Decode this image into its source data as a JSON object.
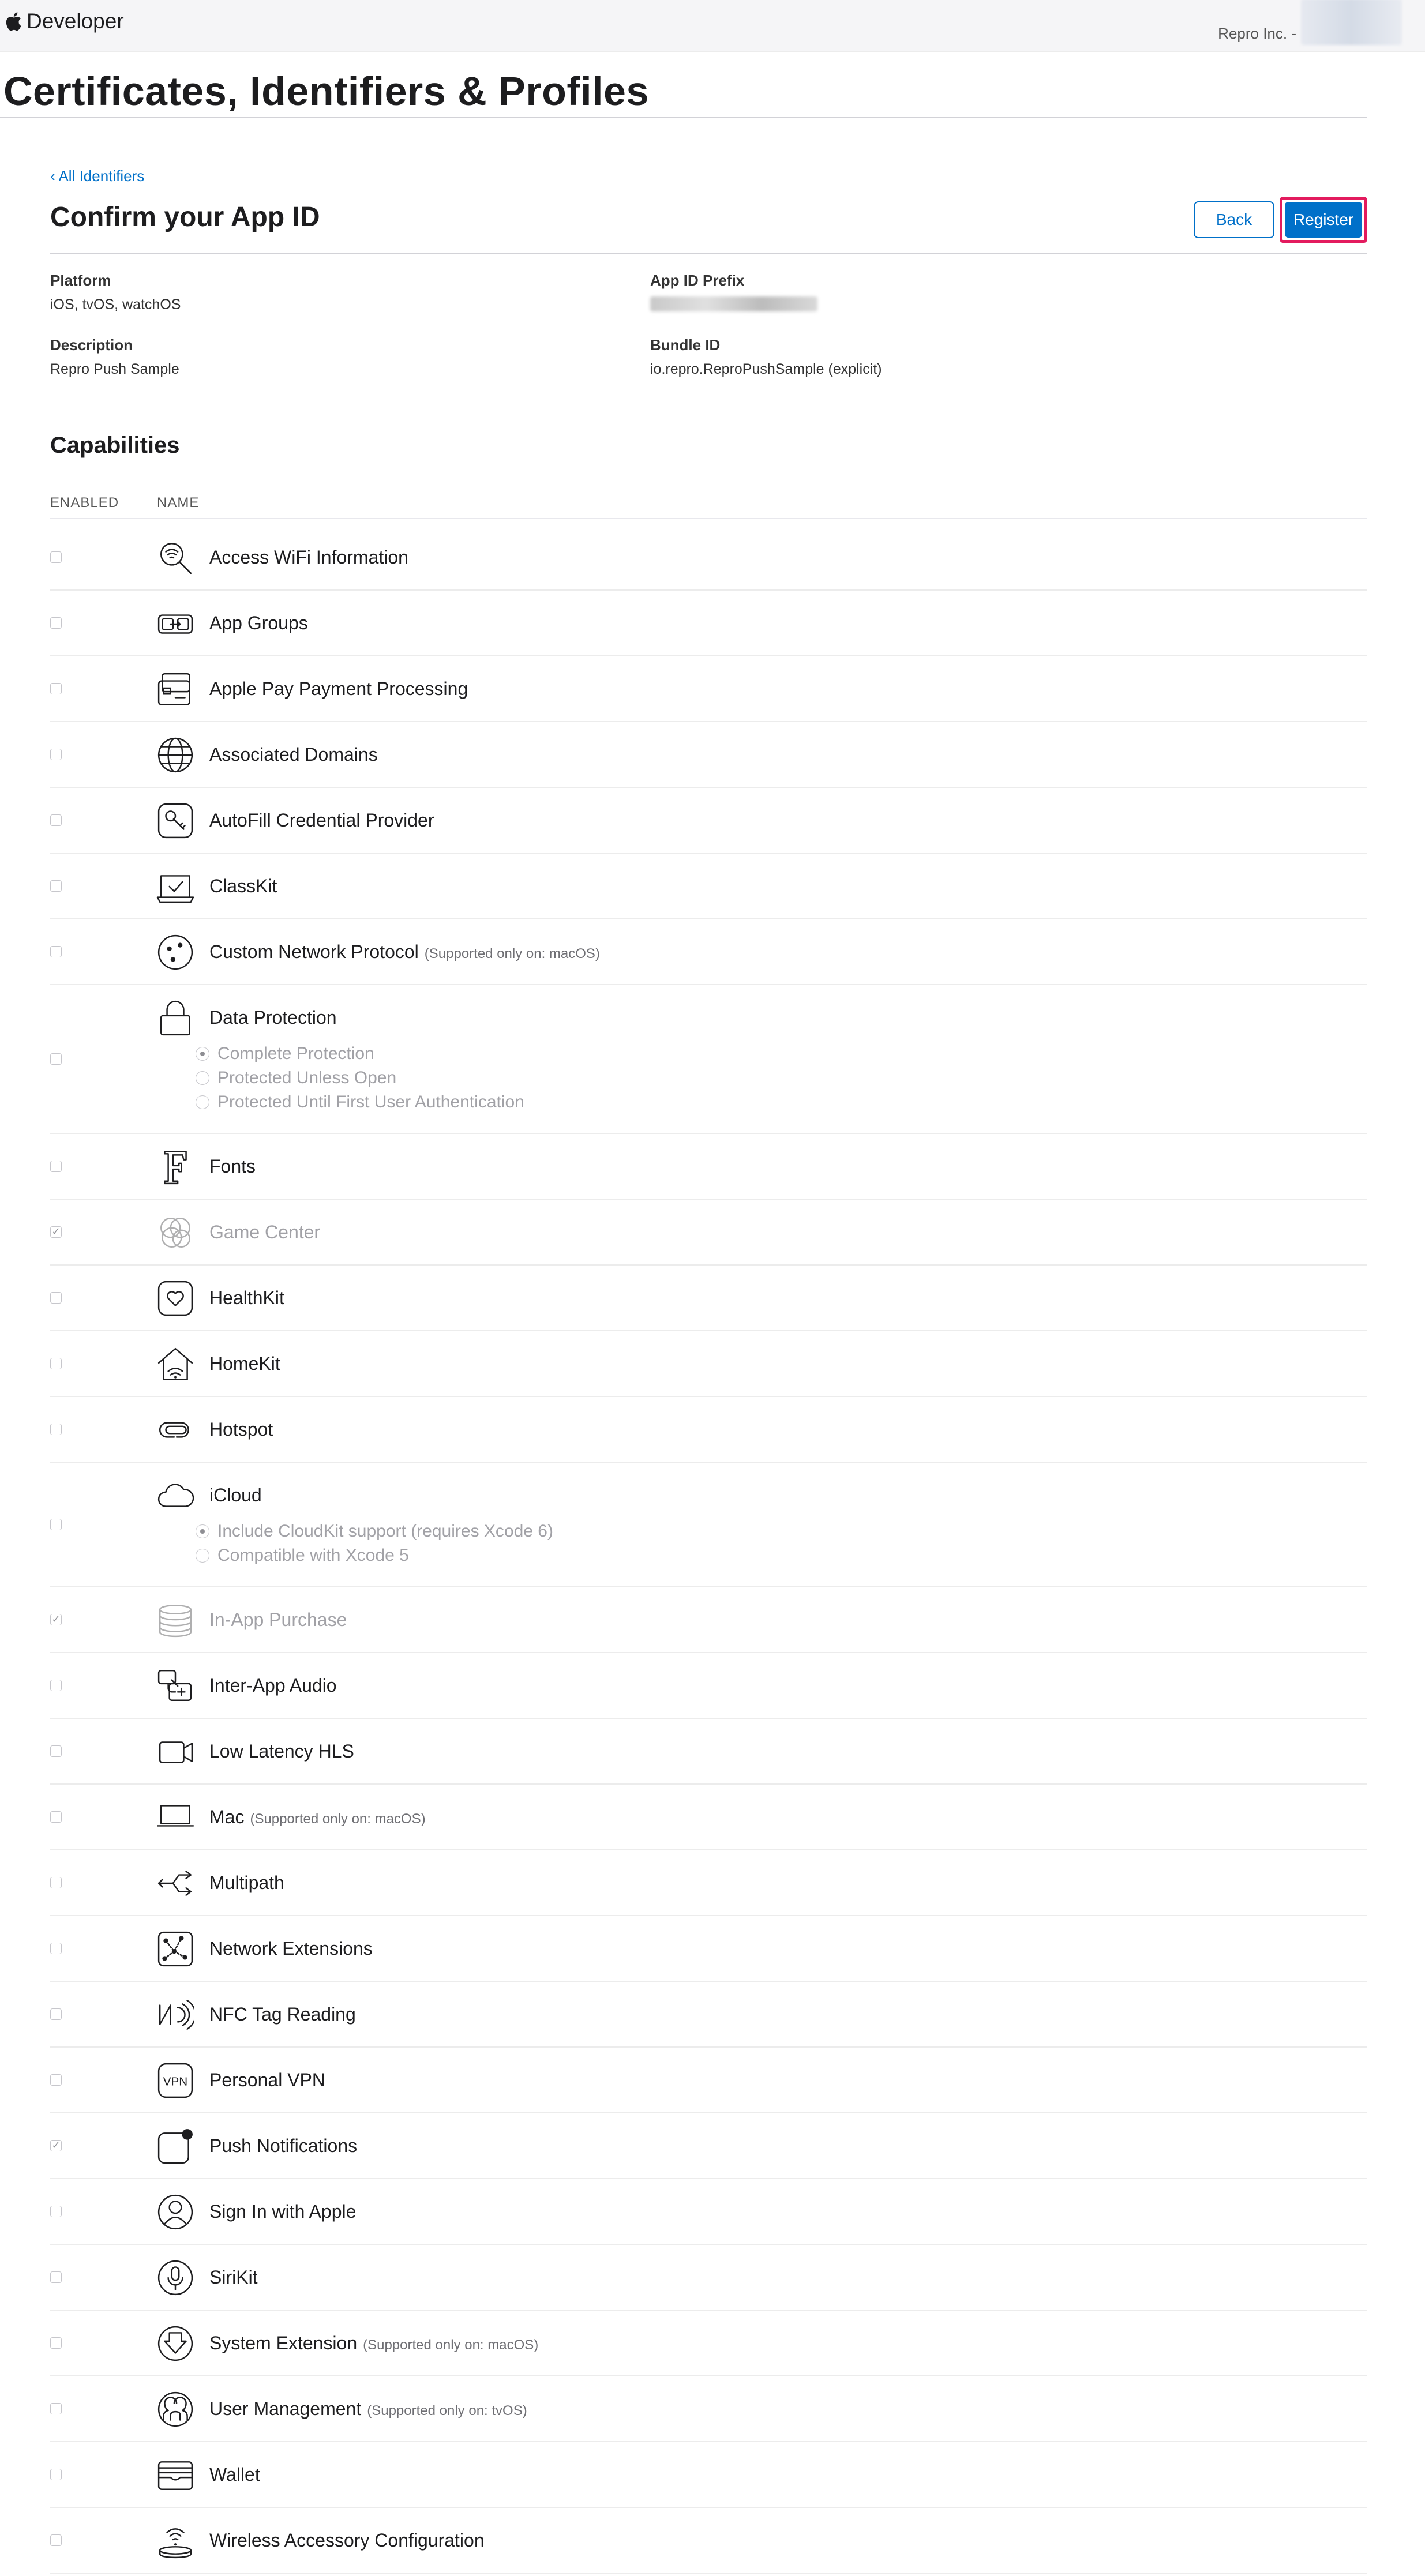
{
  "topbar": {
    "brand": "Developer",
    "account_prefix": "Repro Inc. -"
  },
  "page": {
    "title": "Certificates, Identifiers & Profiles",
    "back_link": "‹ All Identifiers",
    "heading": "Confirm your App ID",
    "back_button": "Back",
    "register_button": "Register"
  },
  "info": {
    "platform_label": "Platform",
    "platform_value": "iOS, tvOS, watchOS",
    "prefix_label": "App ID Prefix",
    "description_label": "Description",
    "description_value": "Repro Push Sample",
    "bundle_label": "Bundle ID",
    "bundle_value": "io.repro.ReproPushSample (explicit)"
  },
  "capabilities": {
    "title": "Capabilities",
    "col_enabled": "ENABLED",
    "col_name": "NAME",
    "items": [
      {
        "name": "Access WiFi Information",
        "checked": false,
        "icon": "wifi-search-icon"
      },
      {
        "name": "App Groups",
        "checked": false,
        "icon": "app-groups-icon"
      },
      {
        "name": "Apple Pay Payment Processing",
        "checked": false,
        "icon": "wallet-card-icon"
      },
      {
        "name": "Associated Domains",
        "checked": false,
        "icon": "globe-icon"
      },
      {
        "name": "AutoFill Credential Provider",
        "checked": false,
        "icon": "key-icon"
      },
      {
        "name": "ClassKit",
        "checked": false,
        "icon": "classkit-icon"
      },
      {
        "name": "Custom Network Protocol",
        "note": "(Supported only on: macOS)",
        "checked": false,
        "icon": "network-dots-icon"
      },
      {
        "name": "Data Protection",
        "checked": false,
        "icon": "lock-icon",
        "options": [
          {
            "label": "Complete Protection",
            "on": true
          },
          {
            "label": "Protected Unless Open",
            "on": false
          },
          {
            "label": "Protected Until First User Authentication",
            "on": false
          }
        ]
      },
      {
        "name": "Fonts",
        "checked": false,
        "icon": "font-icon"
      },
      {
        "name": "Game Center",
        "checked": true,
        "disabled": true,
        "icon": "game-center-icon"
      },
      {
        "name": "HealthKit",
        "checked": false,
        "icon": "heart-icon"
      },
      {
        "name": "HomeKit",
        "checked": false,
        "icon": "home-icon"
      },
      {
        "name": "Hotspot",
        "checked": false,
        "icon": "hotspot-icon"
      },
      {
        "name": "iCloud",
        "checked": false,
        "icon": "cloud-icon",
        "options": [
          {
            "label": "Include CloudKit support (requires Xcode 6)",
            "on": true
          },
          {
            "label": "Compatible with Xcode 5",
            "on": false
          }
        ]
      },
      {
        "name": "In-App Purchase",
        "checked": true,
        "disabled": true,
        "icon": "coins-icon"
      },
      {
        "name": "Inter-App Audio",
        "checked": false,
        "icon": "audio-icon"
      },
      {
        "name": "Low Latency HLS",
        "checked": false,
        "icon": "video-icon"
      },
      {
        "name": "Mac",
        "note": "(Supported only on: macOS)",
        "checked": false,
        "icon": "laptop-icon"
      },
      {
        "name": "Multipath",
        "checked": false,
        "icon": "multipath-icon"
      },
      {
        "name": "Network Extensions",
        "checked": false,
        "icon": "network-extension-icon"
      },
      {
        "name": "NFC Tag Reading",
        "checked": false,
        "icon": "nfc-icon"
      },
      {
        "name": "Personal VPN",
        "checked": false,
        "icon": "vpn-icon"
      },
      {
        "name": "Push Notifications",
        "checked": true,
        "icon": "notification-icon"
      },
      {
        "name": "Sign In with Apple",
        "checked": false,
        "icon": "person-icon"
      },
      {
        "name": "SiriKit",
        "checked": false,
        "icon": "microphone-icon"
      },
      {
        "name": "System Extension",
        "note": "(Supported only on: macOS)",
        "checked": false,
        "icon": "download-icon"
      },
      {
        "name": "User Management",
        "note": "(Supported only on: tvOS)",
        "checked": false,
        "icon": "users-icon"
      },
      {
        "name": "Wallet",
        "checked": false,
        "icon": "wallet-icon"
      },
      {
        "name": "Wireless Accessory Configuration",
        "checked": false,
        "icon": "wireless-accessory-icon"
      }
    ]
  }
}
